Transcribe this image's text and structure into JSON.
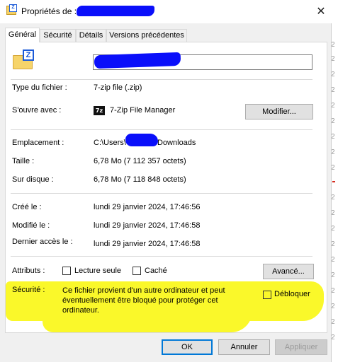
{
  "window": {
    "title_prefix": "Propriétés de :",
    "close_glyph": "✕"
  },
  "tabs": [
    {
      "label": "Général",
      "active": true
    },
    {
      "label": "Sécurité",
      "active": false
    },
    {
      "label": "Détails",
      "active": false
    },
    {
      "label": "Versions précédentes",
      "active": false
    }
  ],
  "general": {
    "file_name_value": "",
    "file_type_label": "Type du fichier :",
    "file_type_value": "7-zip file (.zip)",
    "opens_with_label": "S'ouvre avec :",
    "opens_with_icon_text": "7z",
    "opens_with_value": "7-Zip File Manager",
    "change_button": "Modifier...",
    "location_label": "Emplacement :",
    "location_value_prefix": "C:\\Users\\",
    "location_value_suffix": "Downloads",
    "size_label": "Taille :",
    "size_value": "6,78 Mo (7 112 357 octets)",
    "disk_size_label": "Sur disque :",
    "disk_size_value": "6,78 Mo (7 118 848 octets)",
    "created_label": "Créé le :",
    "created_value": "lundi 29 janvier 2024, 17:46:56",
    "modified_label": "Modifié le :",
    "modified_value": "lundi 29 janvier 2024, 17:46:58",
    "accessed_label": "Dernier accès le :",
    "accessed_value": "lundi 29 janvier 2024, 17:46:58",
    "attributes_label": "Attributs :",
    "readonly_label": "Lecture seule",
    "hidden_label": "Caché",
    "advanced_button": "Avancé...",
    "security_label": "Sécurité :",
    "security_message": "Ce fichier provient d'un autre ordinateur et peut éventuellement être bloqué pour protéger cet ordinateur.",
    "unblock_label": "Débloquer"
  },
  "footer": {
    "ok": "OK",
    "cancel": "Annuler",
    "apply": "Appliquer"
  },
  "colors": {
    "redaction": "#0a0ffa",
    "highlight": "#faf82a",
    "accent": "#0078d7"
  }
}
